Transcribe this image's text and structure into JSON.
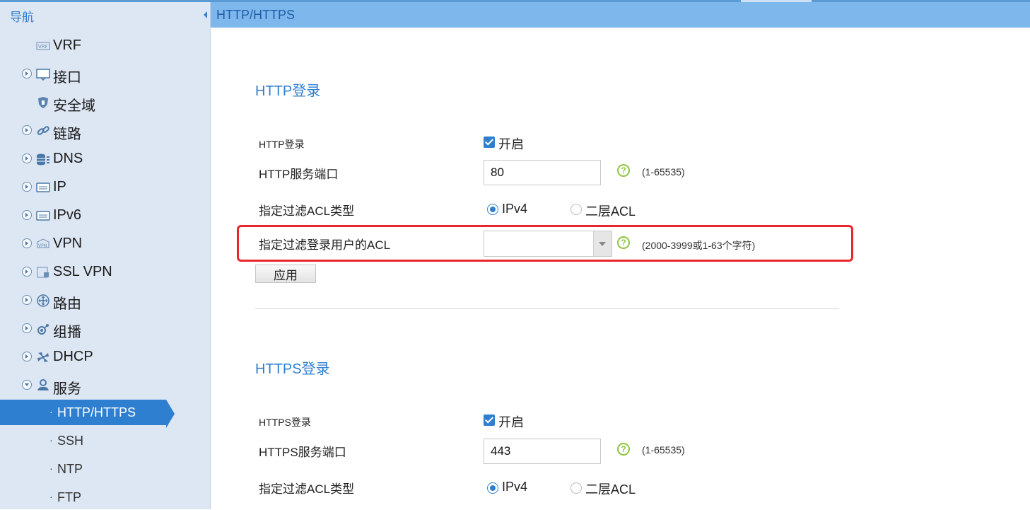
{
  "nav": {
    "title": "导航",
    "items": [
      {
        "label": "VRF",
        "icon": "vrf-icon",
        "expandable": false
      },
      {
        "label": "接口",
        "icon": "interface-icon",
        "expandable": true
      },
      {
        "label": "安全域",
        "icon": "shield-icon",
        "expandable": false
      },
      {
        "label": "链路",
        "icon": "link-icon",
        "expandable": true
      },
      {
        "label": "DNS",
        "icon": "database-icon",
        "expandable": true
      },
      {
        "label": "IP",
        "icon": "ip-icon",
        "expandable": true
      },
      {
        "label": "IPv6",
        "icon": "ipv6-icon",
        "expandable": true
      },
      {
        "label": "VPN",
        "icon": "vpn-icon",
        "expandable": true
      },
      {
        "label": "SSL VPN",
        "icon": "ssl-vpn-icon",
        "expandable": true
      },
      {
        "label": "路由",
        "icon": "route-icon",
        "expandable": true
      },
      {
        "label": "组播",
        "icon": "multicast-icon",
        "expandable": true
      },
      {
        "label": "DHCP",
        "icon": "dhcp-icon",
        "expandable": true
      },
      {
        "label": "服务",
        "icon": "service-icon",
        "expandable": true,
        "expanded": true
      }
    ],
    "sub_items": [
      {
        "label": "HTTP/HTTPS",
        "active": true
      },
      {
        "label": "SSH"
      },
      {
        "label": "NTP"
      },
      {
        "label": "FTP"
      }
    ],
    "bullet": "·"
  },
  "header": {
    "title": "HTTP/HTTPS"
  },
  "http": {
    "section_title": "HTTP登录",
    "login_label": "HTTP登录",
    "enable_label": "开启",
    "port_label": "HTTP服务端口",
    "port_value": "80",
    "port_range": "(1-65535)",
    "acl_type_label": "指定过滤ACL类型",
    "acl_type_options": [
      "IPv4",
      "二层ACL"
    ],
    "acl_user_label": "指定过滤登录用户的ACL",
    "acl_user_value": "",
    "acl_user_range": "(2000-3999或1-63个字符)",
    "apply_label": "应用"
  },
  "https": {
    "section_title": "HTTPS登录",
    "login_label": "HTTPS登录",
    "enable_label": "开启",
    "port_label": "HTTPS服务端口",
    "port_value": "443",
    "port_range": "(1-65535)",
    "acl_type_label": "指定过滤ACL类型",
    "acl_type_options": [
      "IPv4",
      "二层ACL"
    ]
  },
  "help_glyph": "?",
  "colors": {
    "accent": "#2f7fd0",
    "header_bg": "#7eb7ec",
    "sidebar_bg": "#dde6f3",
    "highlight": "#e8262b",
    "help": "#8cc63f"
  }
}
